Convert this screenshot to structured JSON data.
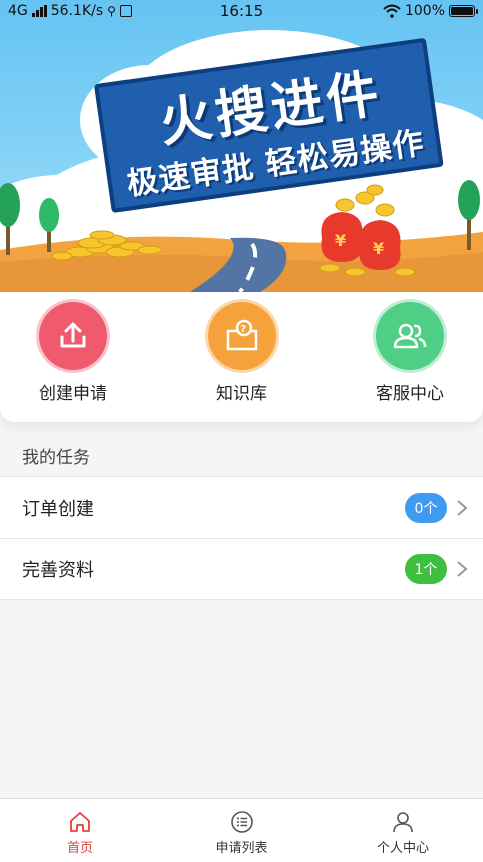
{
  "status_bar": {
    "network": "4G",
    "speed": "56.1K/s",
    "time": "16:15",
    "battery": "100%"
  },
  "banner": {
    "title": "火搜进件",
    "subtitle": "极速审批 轻松易操作"
  },
  "quick_actions": [
    {
      "label": "创建申请",
      "icon": "upload-icon",
      "color": "#ef5a6d"
    },
    {
      "label": "知识库",
      "icon": "question-book-icon",
      "color": "#f6a23c"
    },
    {
      "label": "客服中心",
      "icon": "people-icon",
      "color": "#4fce85"
    }
  ],
  "tasks": {
    "title": "我的任务",
    "items": [
      {
        "label": "订单创建",
        "badge": "0个",
        "badge_color": "#3f9bf0"
      },
      {
        "label": "完善资料",
        "badge": "1个",
        "badge_color": "#3fbf3f"
      }
    ]
  },
  "nav": {
    "active_color": "#e5403b",
    "items": [
      {
        "label": "首页",
        "icon": "home-icon",
        "active": true
      },
      {
        "label": "申请列表",
        "icon": "list-icon",
        "active": false
      },
      {
        "label": "个人中心",
        "icon": "user-icon",
        "active": false
      }
    ]
  }
}
